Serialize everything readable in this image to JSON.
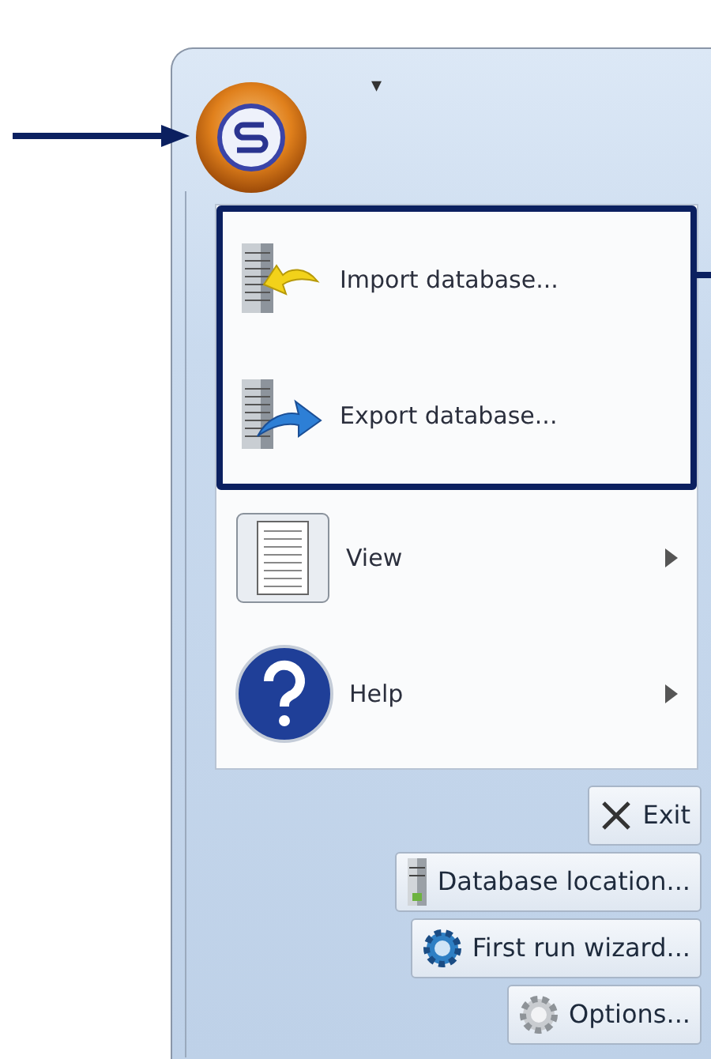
{
  "quick_access": {
    "caret": "▾"
  },
  "menu_items": [
    {
      "kind": "import",
      "label": "Import database...",
      "has_submenu": false,
      "highlighted": true
    },
    {
      "kind": "export",
      "label": "Export database...",
      "has_submenu": false,
      "highlighted": true
    },
    {
      "kind": "view",
      "label": "View",
      "has_submenu": true,
      "highlighted": false
    },
    {
      "kind": "help",
      "label": "Help",
      "has_submenu": true,
      "highlighted": false
    }
  ],
  "footer_buttons": [
    {
      "kind": "exit",
      "label": "Exit"
    },
    {
      "kind": "database",
      "label": "Database location..."
    },
    {
      "kind": "wizard",
      "label": "First run wizard..."
    },
    {
      "kind": "options",
      "label": "Options..."
    }
  ]
}
